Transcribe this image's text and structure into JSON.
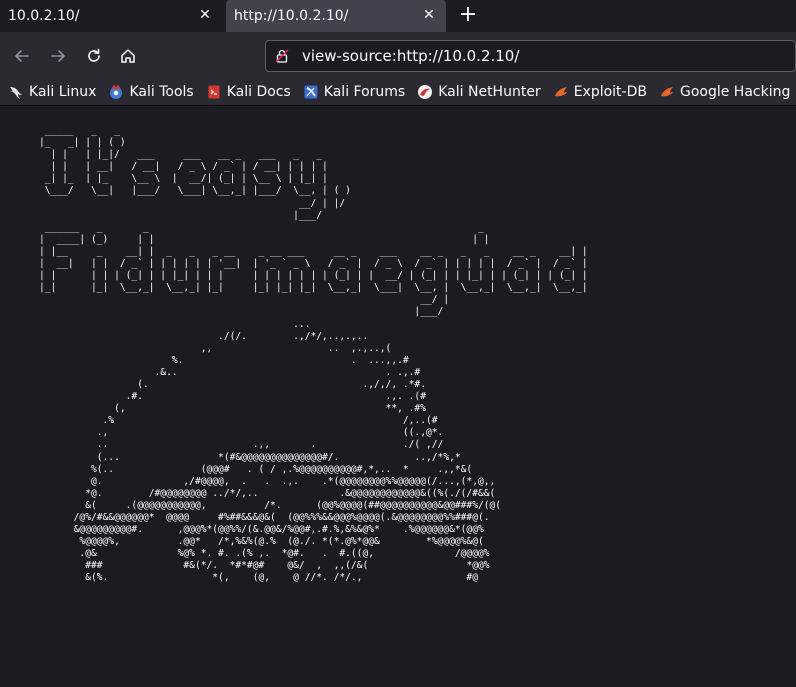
{
  "tabs": [
    {
      "title": "10.0.2.10/",
      "close": "✕"
    },
    {
      "title": "http://10.0.2.10/",
      "close": "✕"
    }
  ],
  "new_tab": "+",
  "url": "view-source:http://10.0.2.10/",
  "bookmarks": [
    {
      "label": "Kali Linux",
      "icon": "kali-dragon-icon",
      "color": "#e6e6e6"
    },
    {
      "label": "Kali Tools",
      "icon": "kali-tools-icon",
      "color": "#3d7bd9"
    },
    {
      "label": "Kali Docs",
      "icon": "kali-docs-icon",
      "color": "#d43a2f"
    },
    {
      "label": "Kali Forums",
      "icon": "kali-forums-icon",
      "color": "#3a6fd1"
    },
    {
      "label": "Kali NetHunter",
      "icon": "nethunter-icon",
      "color": "#d42f2f"
    },
    {
      "label": "Exploit-DB",
      "icon": "exploit-db-icon",
      "color": "#e4672a"
    },
    {
      "label": "Google Hacking DB",
      "icon": "ghdb-icon",
      "color": "#e4672a"
    },
    {
      "label": "",
      "icon": "offsec-icon",
      "color": "#e4672a"
    }
  ],
  "source_lines": [
    " _____   _   _",
    "|_   _| | | ( )",
    "  | |   | |_|/   ___     ___   __ _   ___   _   _",
    "  | |   | __|   / __|   / _ \\ / _` | / __| | | | |",
    " _| |_  | |_    \\__ \\  |  __/| (_| | \\__ \\ | |_| |",
    " \\___/   \\__|   |___/   \\___| \\__,_| |___/  \\__, | ( )",
    "                                             __/ | |/",
    "                                            |___/",
    " ______   _       _                                                         _",
    "|  ____| (_)     | |                                                       | |",
    "| |__     _    __| |  _   _   _ __    _ __ ___     __ _    ___    __ _   _   _    __ _    __| |",
    "|  __|   | |  / _` | | | | | | '__|  | '_ ` _ \\   / _` |  / _ \\  / _` | | | | |  / _` |  / _` |",
    "| |      | | | (_| | | |_| | | |     | | | | | | | (_| | |  __/ | (_| | | |_| | | (_| | | (_| |",
    "|_|      |_|  \\__,_|  \\__,_| |_|     |_| |_| |_|  \\__,_|  \\___|  \\__, |  \\__,_|  \\__,_|  \\__,_|",
    "                                                                  __/ |",
    "                                                                 |___/",
    "                                            ...",
    "                               ./(/.        .,/*/,..,.,..",
    "                            ,,                    ..  ,.,..,(",
    "                       %.                             .  ...,,.#",
    "                    .&..                                    . .,.#",
    "                 (.                                     .,/,/, .*#.",
    "               .#.                                          .,. .(#",
    "             (,                                             **, .#%",
    "           .%                                                  /,..(#",
    "          .,                                                   ((.,@*.",
    "          ..                         .,,       .               ./( ,//",
    "          (...                 *(#&@@@@@@@@@@@@@@#/.             ..,/*%,*",
    "         %(..               (@@@#   . ( / ,.%@@@@@@@@@@#,*,..  *     .,,*&(",
    "         @.              ,/#@@@@,  .   .  .,.    .*(@@@@@@@@%%@@@@@(/...,(*,@,,",
    "        *@.        /#@@@@@@@@ ../*/,..              .&@@@@@@@@@@@@&((%(./(/#&&(",
    "        &(     .(@@@@@@@@@@@,          /*.      (@@%@@@@(##@@@@@@@@@@&@@###%/(@(",
    "      /@%/#&&@@@@@@*  @@@@     #%##&&&@&(  (@@%%%&&@@@%@@@@(.&@@@@@@@@%%###@(.",
    "      &@@@@@@@@@#.      ,@@@%*(@@%%/(&.@@&/%@@#,.#.%,&%&@%*    .%@@@@@@&*(@@%",
    "       %@@@@%,          .@@*   /*,%&%(@.%  (@./. *(*.@%*@@&        *%@@@@%&@(",
    "       .@&              %@% *. #. .(% ,.  *@#.   .  #.((@,              /@@@@%",
    "        ###              #&(*/.  *#*#@#    @&/  ,  ,,(/&(                 *@@%",
    "        &(%.                  *(,    (@,    @ //*. /*/.,                  #@"
  ]
}
